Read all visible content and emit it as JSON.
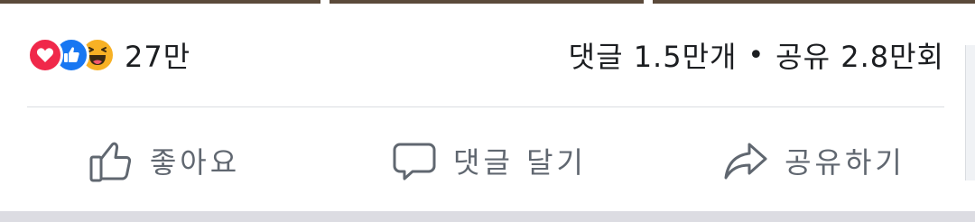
{
  "summary": {
    "reaction_icons": [
      "love-icon",
      "like-icon",
      "haha-icon"
    ],
    "reaction_count": "27만",
    "comments": "댓글 1.5만개",
    "separator": "•",
    "shares": "공유 2.8만회"
  },
  "actions": {
    "like_label": "좋아요",
    "comment_label": "댓글 달기",
    "share_label": "공유하기"
  },
  "colors": {
    "love": "#f0284a",
    "like": "#1877f2",
    "haha": "#f7b125",
    "action_text": "#606770"
  }
}
